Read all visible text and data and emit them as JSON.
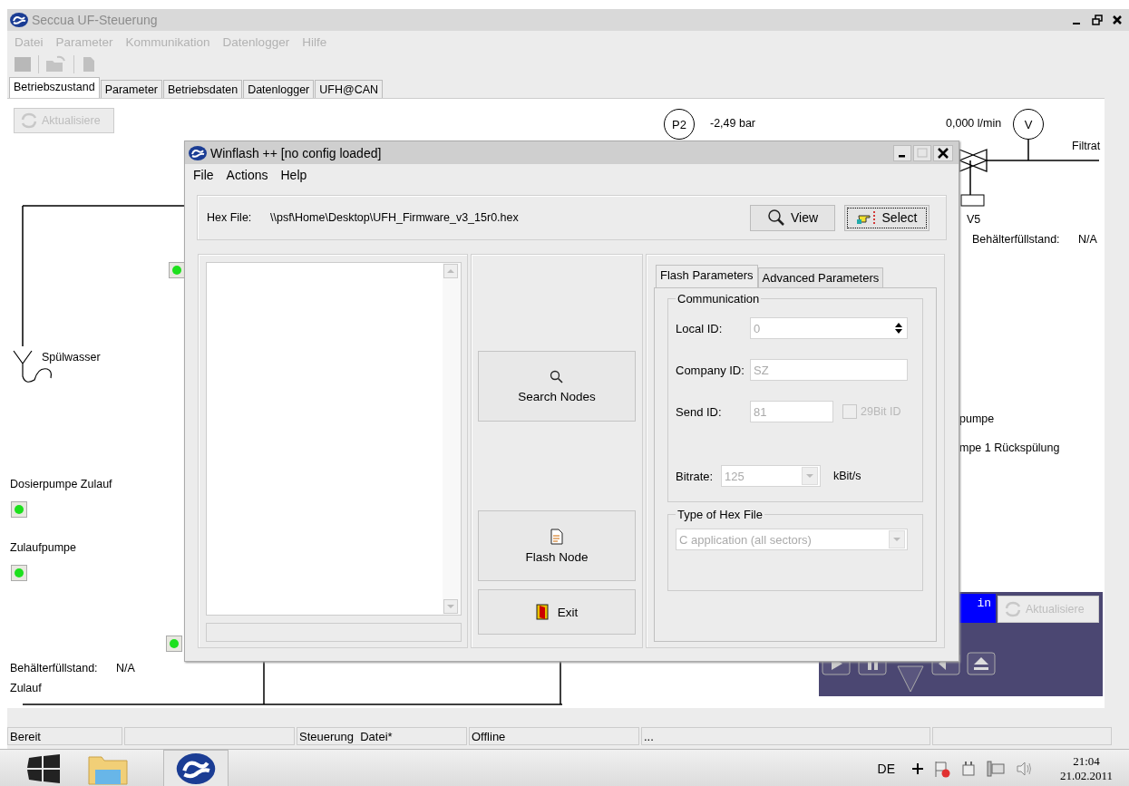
{
  "window": {
    "title": "Seccua UF-Steuerung"
  },
  "menu": [
    {
      "label": "Datei",
      "disabled": true
    },
    {
      "label": "Parameter",
      "disabled": true
    },
    {
      "label": "Kommunikation",
      "disabled": true
    },
    {
      "label": "Datenlogger",
      "disabled": true
    },
    {
      "label": "Hilfe",
      "disabled": true
    }
  ],
  "tabs": [
    {
      "label": "Betriebszustand",
      "selected": true
    },
    {
      "label": "Parameter",
      "selected": false
    },
    {
      "label": "Betriebsdaten",
      "selected": false
    },
    {
      "label": "Datenlogger",
      "selected": false
    },
    {
      "label": "UFH@CAN",
      "selected": false
    }
  ],
  "schematic": {
    "refresh_button": {
      "label": "Aktualisiere",
      "disabled": true
    },
    "gauges": [
      {
        "symbol": "P2",
        "reading": "-2,49 bar"
      },
      {
        "symbol": "V",
        "reading": "0,000 l/min"
      }
    ],
    "labels": [
      {
        "text": "Filtrat"
      },
      {
        "text": "V5"
      },
      {
        "text": "Spülwasser"
      },
      {
        "text": "pumpe"
      },
      {
        "text": "mpe 1 Rückspülung"
      },
      {
        "text": "Dosierpumpe Zulauf"
      },
      {
        "text": "Zulaufpumpe"
      },
      {
        "text": "Zulauf"
      }
    ],
    "levels": [
      {
        "label": "Behälterfüllstand:",
        "value": "N/A"
      },
      {
        "label": "Behälterfüllstand:",
        "value": "N/A"
      }
    ],
    "indicators": [
      {
        "on": true
      },
      {
        "on": true
      },
      {
        "on": true
      },
      {
        "on": true
      }
    ],
    "media_panel": {
      "display": "in",
      "refresh_button": {
        "label": "Aktualisiere",
        "disabled": true
      }
    }
  },
  "dialog": {
    "title": "Winflash ++ [no config loaded]",
    "menu": [
      "File",
      "Actions",
      "Help"
    ],
    "hex_file": {
      "label": "Hex File:",
      "value": "\\\\psf\\Home\\Desktop\\UFH_Firmware_v3_15r0.hex"
    },
    "file_buttons": [
      {
        "kind": "view",
        "label": "View",
        "focused": false
      },
      {
        "kind": "select",
        "label": "Select",
        "focused": true
      }
    ],
    "actions": [
      {
        "kind": "search",
        "label": "Search Nodes"
      },
      {
        "kind": "flash",
        "label": "Flash Node"
      },
      {
        "kind": "exit",
        "label": "Exit"
      }
    ],
    "tabs": [
      {
        "label": "Flash Parameters",
        "selected": true
      },
      {
        "label": "Advanced Parameters",
        "selected": false
      }
    ],
    "communication": {
      "title": "Communication",
      "fields": [
        {
          "kind": "spin",
          "label": "Local ID:",
          "value": "0",
          "disabled": true
        },
        {
          "kind": "text",
          "label": "Company ID:",
          "value": "SZ",
          "disabled": true
        },
        {
          "kind": "text",
          "label": "Send ID:",
          "value": "81",
          "disabled": true,
          "checkbox": {
            "label": "29Bit ID",
            "checked": false,
            "disabled": true
          }
        },
        {
          "kind": "combo",
          "label": "Bitrate:",
          "value": "125",
          "unit": "kBit/s",
          "disabled": true
        }
      ]
    },
    "hex_type": {
      "title": "Type of Hex File",
      "value": "C application (all sectors)",
      "disabled": true
    }
  },
  "status_bar": [
    {
      "text": "Bereit"
    },
    {
      "text": "Steuerung  Datei*"
    },
    {
      "text": "Offline"
    },
    {
      "text": "..."
    }
  ],
  "taskbar": {
    "language": "DE",
    "clock_time": "21:04",
    "clock_date": "21.02.2011"
  }
}
